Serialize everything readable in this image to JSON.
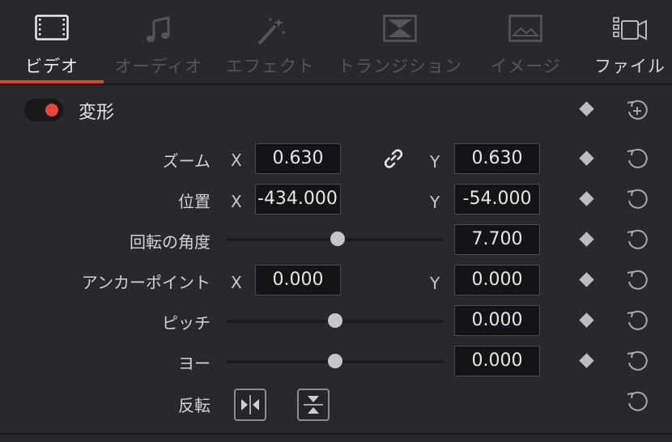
{
  "tabs": [
    {
      "label": "ビデオ",
      "icon": "film-icon",
      "active": true
    },
    {
      "label": "オーディオ",
      "icon": "music-note-icon",
      "active": false
    },
    {
      "label": "エフェクト",
      "icon": "magic-wand-icon",
      "active": false
    },
    {
      "label": "トランジション",
      "icon": "transition-icon",
      "active": false
    },
    {
      "label": "イメージ",
      "icon": "image-icon",
      "active": false
    },
    {
      "label": "ファイル",
      "icon": "file-camera-icon",
      "active": false
    }
  ],
  "section": {
    "title": "変形",
    "enabled": true
  },
  "rows": {
    "zoom": {
      "label": "ズーム",
      "x_axis": "X",
      "x": "0.630",
      "y_axis": "Y",
      "y": "0.630"
    },
    "position": {
      "label": "位置",
      "x_axis": "X",
      "x": "-434.000",
      "y_axis": "Y",
      "y": "-54.000"
    },
    "rotation": {
      "label": "回転の角度",
      "value": "7.700",
      "slider_fraction": 0.51
    },
    "anchor": {
      "label": "アンカーポイント",
      "x_axis": "X",
      "x": "0.000",
      "y_axis": "Y",
      "y": "0.000"
    },
    "pitch": {
      "label": "ピッチ",
      "value": "0.000",
      "slider_fraction": 0.5
    },
    "yaw": {
      "label": "ヨー",
      "value": "0.000",
      "slider_fraction": 0.5
    },
    "flip": {
      "label": "反転"
    }
  },
  "colors": {
    "accent": "#d9463c",
    "toggle_on": "#e8453c"
  }
}
